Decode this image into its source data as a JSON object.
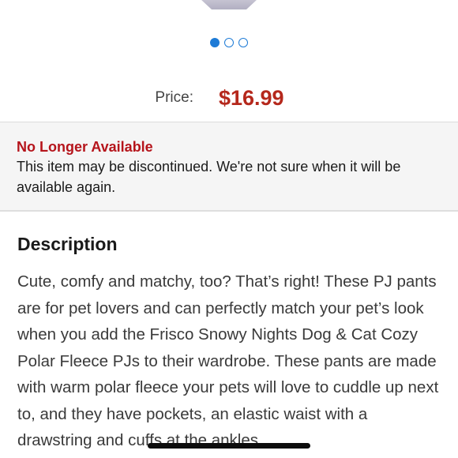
{
  "carousel": {
    "dot_count": 3,
    "active_index": 0,
    "accent_color": "#1e7bd6"
  },
  "price": {
    "label": "Price:",
    "value": "$16.99",
    "color": "#b5281c"
  },
  "availability": {
    "title": "No Longer Available",
    "message": "This item may be discontinued. We're not sure when it will be available again.",
    "title_color": "#b5141b"
  },
  "description": {
    "heading": "Description",
    "body": "Cute, comfy and matchy, too? That’s right! These PJ pants are for pet lovers and can perfectly match your pet’s look when you add the Frisco Snowy Nights Dog & Cat Cozy Polar Fleece PJs to their wardrobe. These pants are made with warm polar fleece your pets will love to cuddle up next to, and they have pockets, an elastic waist with a drawstring and cuffs at the ankles"
  }
}
